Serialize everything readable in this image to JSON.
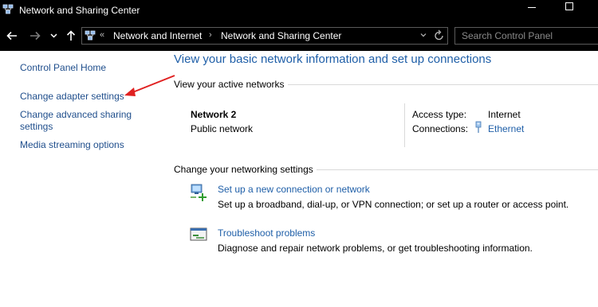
{
  "window": {
    "title": "Network and Sharing Center"
  },
  "address_bar": {
    "overflow": "«",
    "crumbs": [
      "Network and Internet",
      "Network and Sharing Center"
    ],
    "separator": "›"
  },
  "search": {
    "placeholder": "Search Control Panel"
  },
  "left_pane": {
    "home": "Control Panel Home",
    "adapter": "Change adapter settings",
    "advanced_line1": "Change advanced sharing",
    "advanced_line2": "settings",
    "media": "Media streaming options"
  },
  "main": {
    "heading": "View your basic network information and set up connections",
    "active_label": "View your active networks",
    "network": {
      "name": "Network 2",
      "category": "Public network",
      "access_type_label": "Access type:",
      "access_type_value": "Internet",
      "connections_label": "Connections:",
      "connections_value": "Ethernet"
    },
    "change_label": "Change your networking settings",
    "tasks": [
      {
        "title": "Set up a new connection or network",
        "desc": "Set up a broadband, dial-up, or VPN connection; or set up a router or access point.",
        "icon": "new-connection-icon"
      },
      {
        "title": "Troubleshoot problems",
        "desc": "Diagnose and repair network problems, or get troubleshooting information.",
        "icon": "troubleshoot-icon"
      }
    ]
  },
  "colors": {
    "link": "#1f5fa8",
    "left_link": "#1f4e8c",
    "annotation_arrow": "#e02020",
    "chrome": "#000000"
  }
}
